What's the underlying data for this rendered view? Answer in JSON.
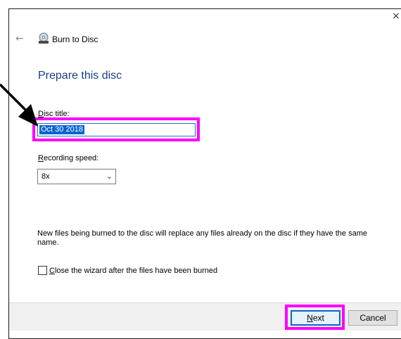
{
  "window": {
    "close_glyph": "×"
  },
  "header": {
    "back_glyph": "←",
    "title": "Burn to Disc",
    "icon": "disc-burner-icon"
  },
  "page": {
    "heading": "Prepare this disc"
  },
  "disc_title": {
    "label_accel": "D",
    "label_rest": "isc title:",
    "value": "Oct 30 2018"
  },
  "recording_speed": {
    "label_accel": "R",
    "label_rest": "ecording speed:",
    "selected": "8x",
    "chevron": "⌄"
  },
  "notice": "New files being burned to the disc will replace any files already on the disc if they have the same name.",
  "close_wizard": {
    "checked": false,
    "label_accel": "C",
    "label_rest": "lose the wizard after the files have been burned"
  },
  "buttons": {
    "next_accel": "N",
    "next_rest": "ext",
    "cancel": "Cancel"
  },
  "annotation": {
    "highlight_color": "#ff00ff",
    "arrow_color": "#000000"
  }
}
